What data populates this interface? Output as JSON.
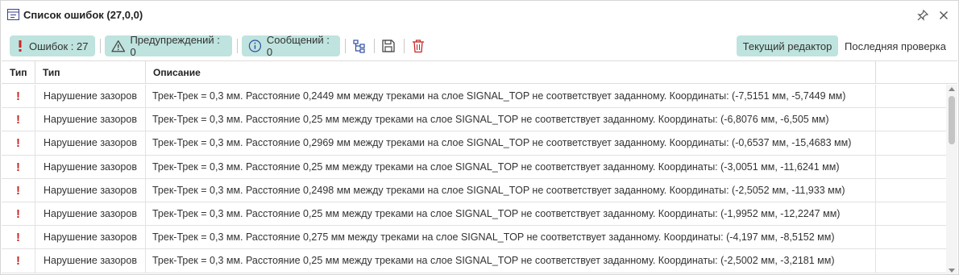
{
  "window": {
    "title": "Список ошибок (27,0,0)",
    "pin_icon": "pin-icon",
    "close_icon": "close-icon"
  },
  "toolbar": {
    "errors_label": "Ошибок : 27",
    "warnings_label": "Предупреждений : 0",
    "messages_label": "Сообщений : 0",
    "tree_icon": "hierarchy-icon",
    "save_icon": "save-icon",
    "delete_icon": "trash-icon",
    "tab_current": "Текущий редактор",
    "tab_last": "Последняя проверка",
    "accent_color": "#bfe3de",
    "error_color": "#c62828"
  },
  "table": {
    "columns": [
      "Тип",
      "Тип",
      "Описание"
    ],
    "rows": [
      {
        "icon": "!",
        "type": "Нарушение зазоров",
        "description": "Трек-Трек = 0,3 мм. Расстояние 0,2449 мм между треками на слое SIGNAL_TOP не соответствует заданному. Координаты: (-7,5151 мм, -5,7449 мм)"
      },
      {
        "icon": "!",
        "type": "Нарушение зазоров",
        "description": "Трек-Трек = 0,3 мм. Расстояние 0,25 мм между треками на слое SIGNAL_TOP не соответствует заданному. Координаты: (-6,8076 мм, -6,505 мм)"
      },
      {
        "icon": "!",
        "type": "Нарушение зазоров",
        "description": "Трек-Трек = 0,3 мм. Расстояние 0,2969 мм между треками на слое SIGNAL_TOP не соответствует заданному. Координаты: (-0,6537 мм, -15,4683 мм)"
      },
      {
        "icon": "!",
        "type": "Нарушение зазоров",
        "description": "Трек-Трек = 0,3 мм. Расстояние 0,25 мм между треками на слое SIGNAL_TOP не соответствует заданному. Координаты: (-3,0051 мм, -11,6241 мм)"
      },
      {
        "icon": "!",
        "type": "Нарушение зазоров",
        "description": "Трек-Трек = 0,3 мм. Расстояние 0,2498 мм между треками на слое SIGNAL_TOP не соответствует заданному. Координаты: (-2,5052 мм, -11,933 мм)"
      },
      {
        "icon": "!",
        "type": "Нарушение зазоров",
        "description": "Трек-Трек = 0,3 мм. Расстояние 0,25 мм между треками на слое SIGNAL_TOP не соответствует заданному. Координаты: (-1,9952 мм, -12,2247 мм)"
      },
      {
        "icon": "!",
        "type": "Нарушение зазоров",
        "description": "Трек-Трек = 0,3 мм. Расстояние 0,275 мм между треками на слое SIGNAL_TOP не соответствует заданному. Координаты: (-4,197 мм, -8,5152 мм)"
      },
      {
        "icon": "!",
        "type": "Нарушение зазоров",
        "description": "Трек-Трек = 0,3 мм. Расстояние 0,25 мм между треками на слое SIGNAL_TOP не соответствует заданному. Координаты: (-2,5002 мм, -3,2181 мм)"
      }
    ]
  }
}
